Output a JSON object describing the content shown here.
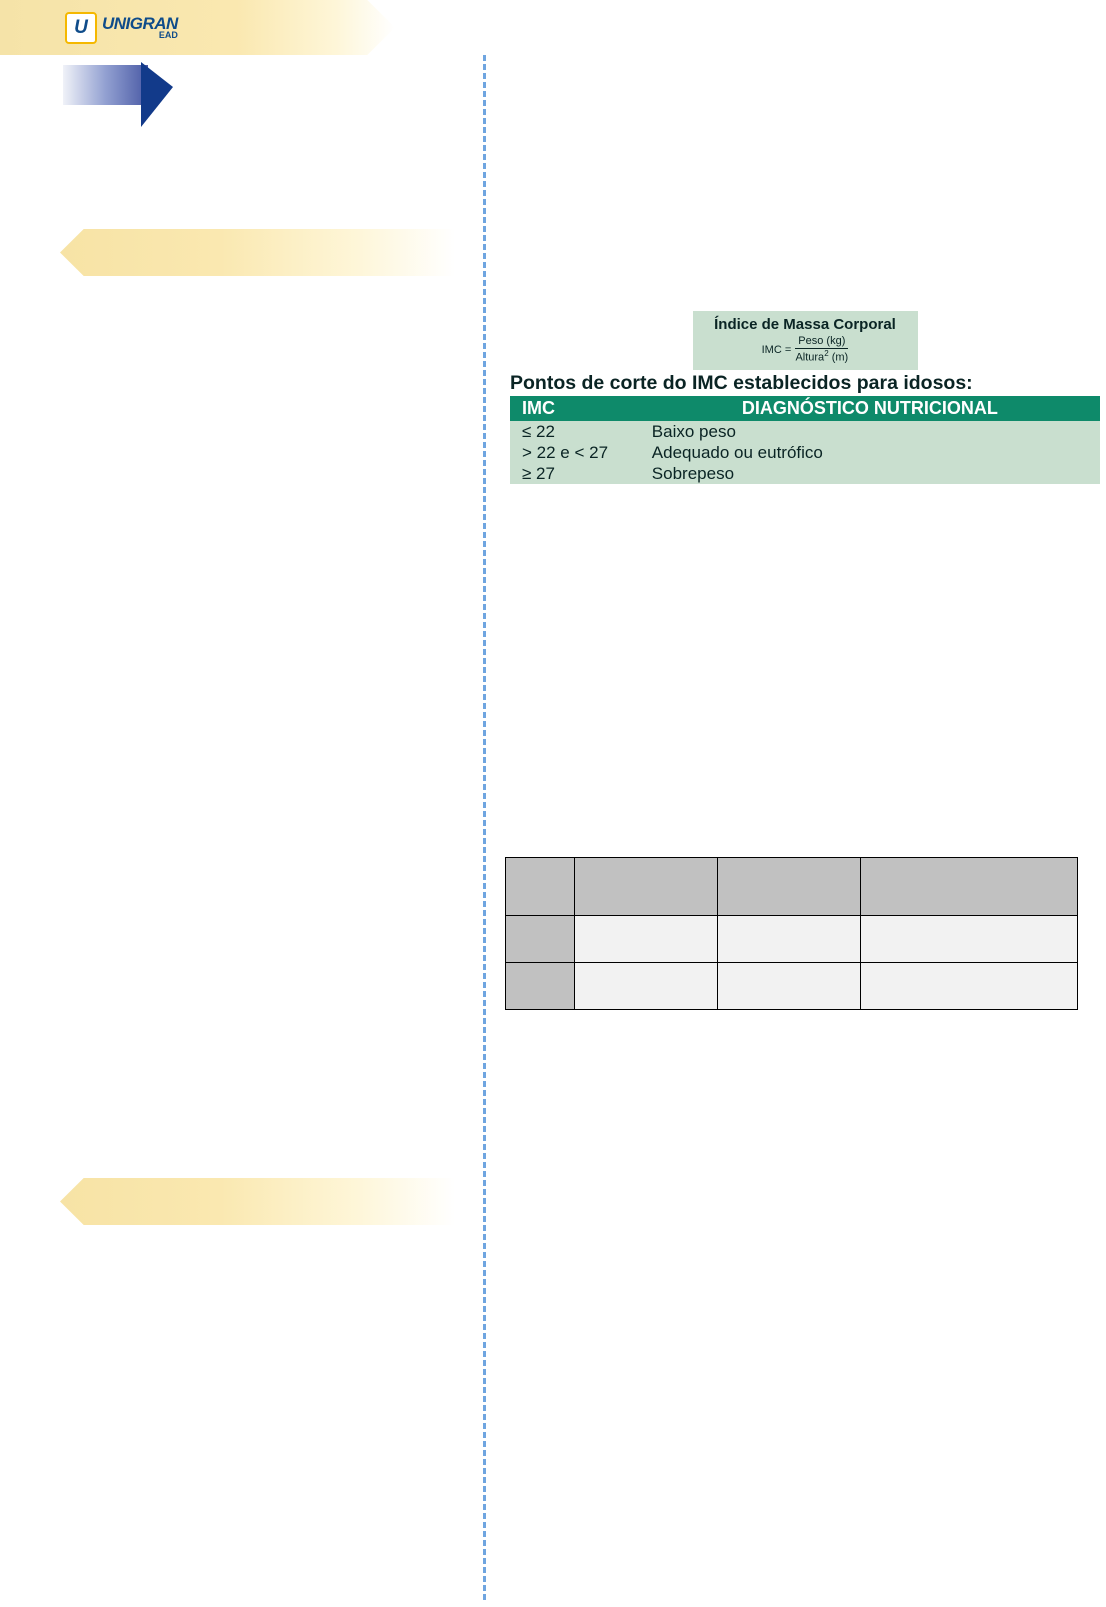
{
  "logo": {
    "letter": "U",
    "brand": "UNIGRAN",
    "sub": "EAD"
  },
  "imc": {
    "title": "Índice de Massa Corporal",
    "formula_lhs": "IMC =",
    "formula_top": "Peso (kg)",
    "formula_bot_pre": "Altura",
    "formula_bot_exp": "2",
    "formula_bot_post": " (m)",
    "cutoff_heading": "Pontos de corte do IMC establecidos para idosos:",
    "header1": "IMC",
    "header2": "DIAGNÓSTICO NUTRICIONAL",
    "rows": [
      {
        "imc": "≤ 22",
        "diag": "Baixo peso"
      },
      {
        "imc": "> 22 e < 27",
        "diag": "Adequado ou eutrófico"
      },
      {
        "imc": "≥ 27",
        "diag": "Sobrepeso"
      }
    ]
  }
}
